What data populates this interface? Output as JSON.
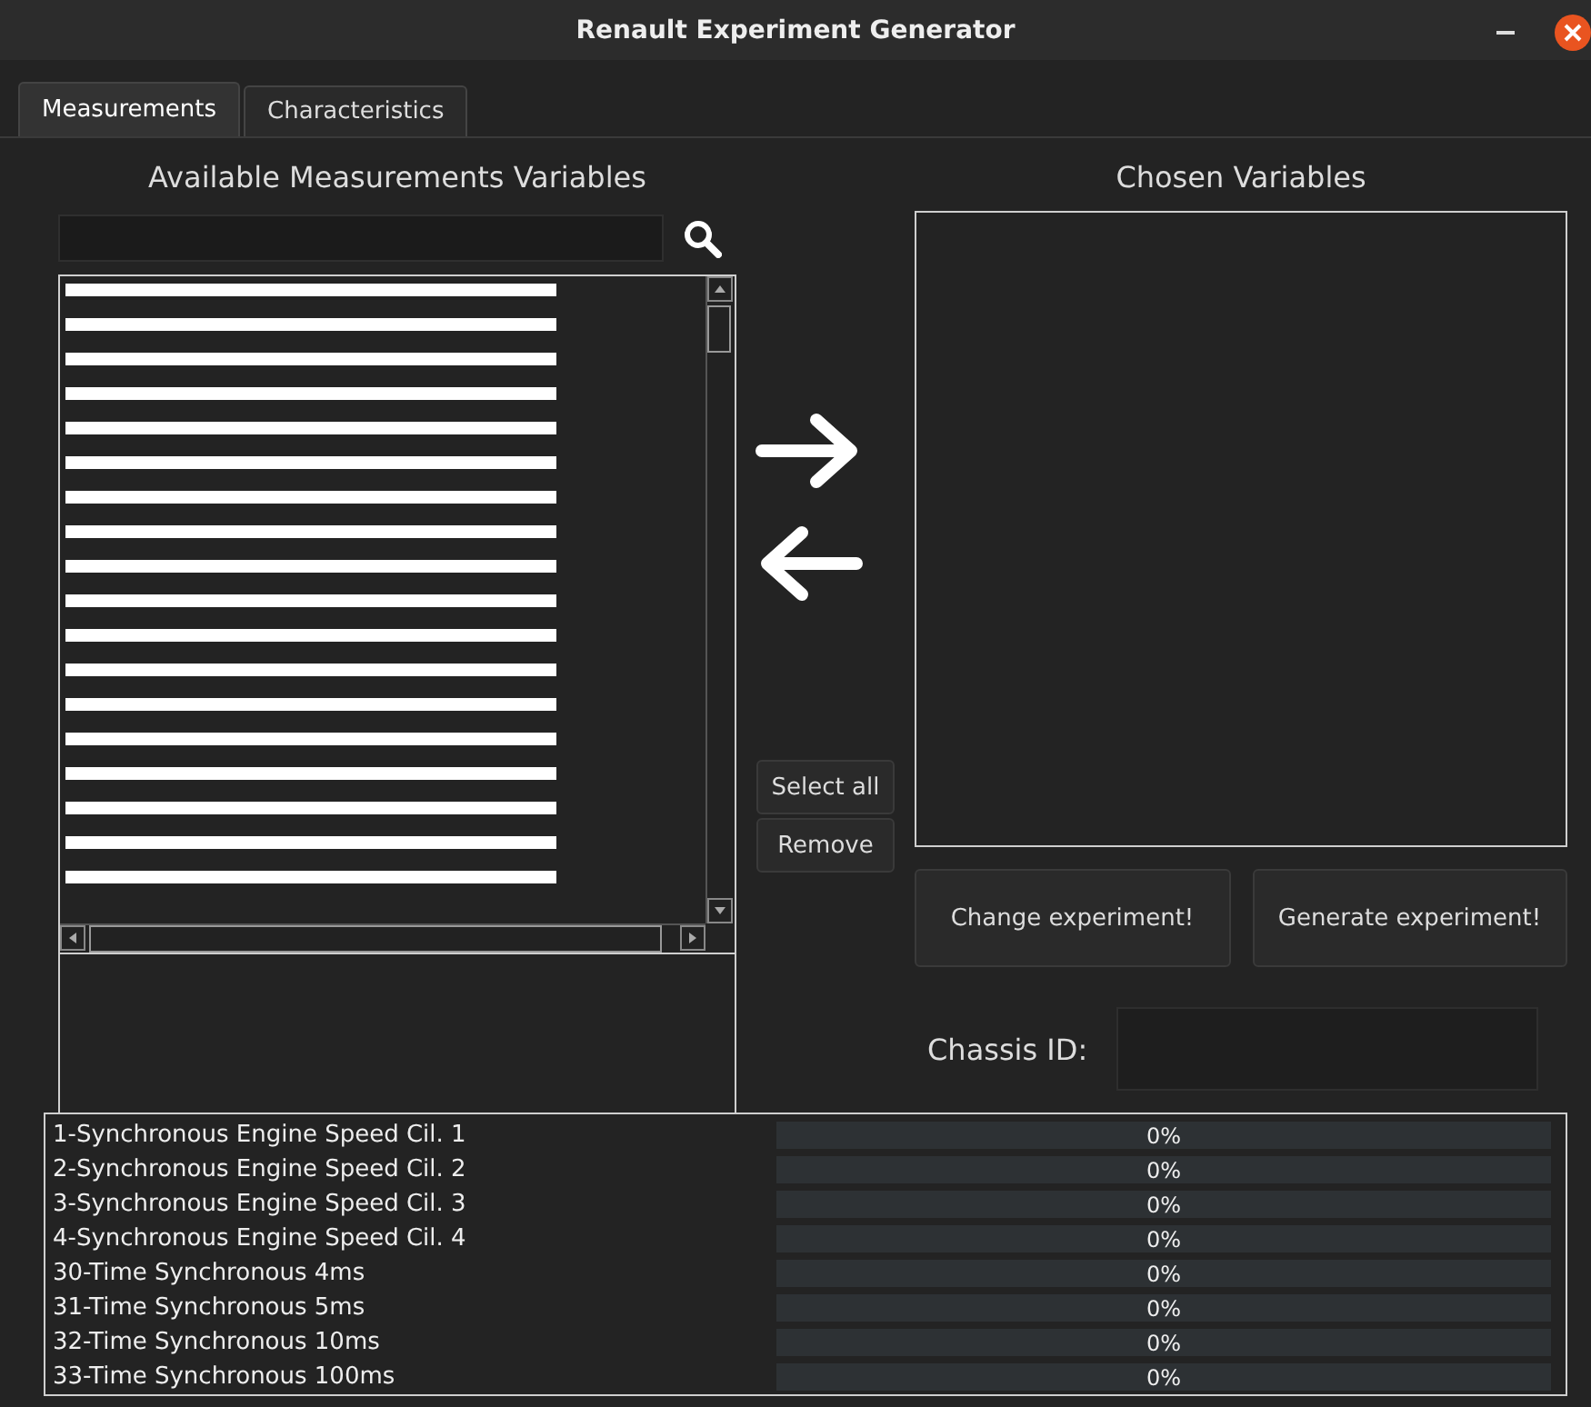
{
  "window": {
    "title": "Renault Experiment Generator"
  },
  "tabs": [
    {
      "label": "Measurements",
      "selected": true
    },
    {
      "label": "Characteristics",
      "selected": false
    }
  ],
  "available": {
    "heading": "Available Measurements Variables",
    "items": [
      {
        "kind": "redacted"
      },
      {
        "kind": "redacted"
      },
      {
        "kind": "redacted"
      },
      {
        "kind": "redacted"
      },
      {
        "kind": "redacted"
      },
      {
        "kind": "redacted"
      },
      {
        "kind": "redacted"
      },
      {
        "kind": "redacted"
      },
      {
        "kind": "redacted"
      },
      {
        "kind": "redacted"
      },
      {
        "kind": "redacted"
      },
      {
        "kind": "redacted"
      },
      {
        "kind": "redacted"
      },
      {
        "kind": "redacted"
      },
      {
        "kind": "redacted"
      },
      {
        "kind": "redacted"
      },
      {
        "kind": "redacted"
      },
      {
        "kind": "redacted"
      }
    ]
  },
  "chosen": {
    "heading": "Chosen Variables"
  },
  "buttons": {
    "select_all": "Select all",
    "remove": "Remove",
    "change": "Change experiment!",
    "generate": "Generate experiment!"
  },
  "chassis": {
    "label": "Chassis ID:"
  },
  "progress": [
    {
      "name": "1-Synchronous Engine Speed Cil. 1",
      "level": 0,
      "reading": "0%"
    },
    {
      "name": "2-Synchronous Engine Speed Cil. 2",
      "level": 0,
      "reading": "0%"
    },
    {
      "name": "3-Synchronous Engine Speed Cil. 3",
      "level": 0,
      "reading": "0%"
    },
    {
      "name": "4-Synchronous Engine Speed Cil. 4",
      "level": 0,
      "reading": "0%"
    },
    {
      "name": "30-Time Synchronous 4ms",
      "level": 0,
      "reading": "0%"
    },
    {
      "name": "31-Time Synchronous 5ms",
      "level": 0,
      "reading": "0%"
    },
    {
      "name": "32-Time Synchronous 10ms",
      "level": 0,
      "reading": "0%"
    },
    {
      "name": "33-Time Synchronous 100ms",
      "level": 0,
      "reading": "0%"
    }
  ]
}
